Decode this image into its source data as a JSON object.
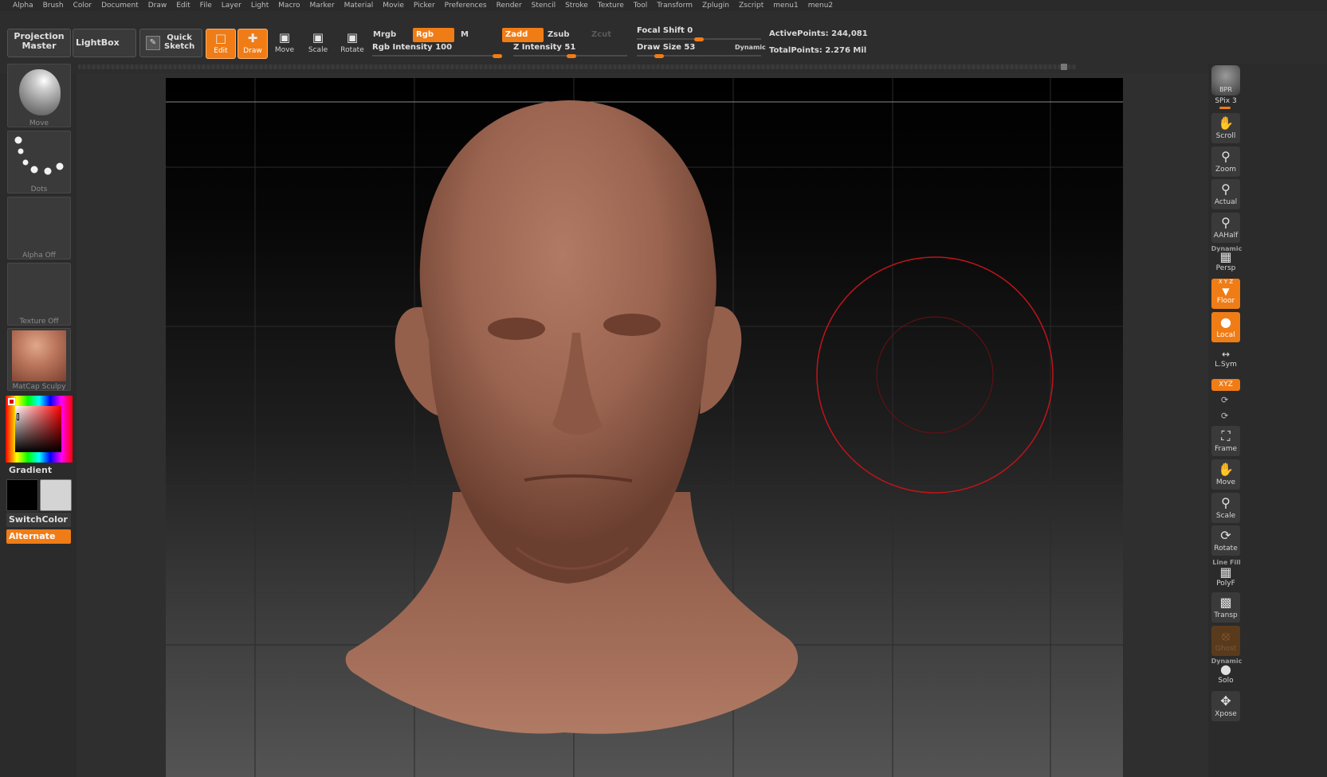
{
  "menu": [
    "Alpha",
    "Brush",
    "Color",
    "Document",
    "Draw",
    "Edit",
    "File",
    "Layer",
    "Light",
    "Macro",
    "Marker",
    "Material",
    "Movie",
    "Picker",
    "Preferences",
    "Render",
    "Stencil",
    "Stroke",
    "Texture",
    "Tool",
    "Transform",
    "Zplugin",
    "Zscript",
    "menu1",
    "menu2"
  ],
  "shelf": {
    "projection_master_line1": "Projection",
    "projection_master_line2": "Master",
    "lightbox": "LightBox",
    "quick_sketch_line1": "Quick",
    "quick_sketch_line2": "Sketch",
    "edit": "Edit",
    "draw": "Draw",
    "move": "Move",
    "scale": "Scale",
    "rotate": "Rotate",
    "mrgb": "Mrgb",
    "rgb": "Rgb",
    "m": "M",
    "zadd": "Zadd",
    "zsub": "Zsub",
    "zcut": "Zcut",
    "rgb_intensity_label": "Rgb Intensity",
    "rgb_intensity_value": "100",
    "z_intensity_label": "Z Intensity",
    "z_intensity_value": "51",
    "focal_shift_label": "Focal Shift",
    "focal_shift_value": "0",
    "draw_size_label": "Draw Size",
    "draw_size_value": "53",
    "dynamic": "Dynamic",
    "active_points_label": "ActivePoints:",
    "active_points_value": "244,081",
    "total_points_label": "TotalPoints:",
    "total_points_value": "2.276 Mil",
    "rgb_intensity_fraction": 1.0,
    "z_intensity_fraction": 0.51,
    "focal_shift_fraction": 0.5,
    "draw_size_fraction": 0.15
  },
  "left_tray": {
    "brush_label": "Move",
    "stroke_label": "Dots",
    "alpha_label": "Alpha  Off",
    "texture_label": "Texture  Off",
    "material_label": "MatCap  Sculpy",
    "gradient": "Gradient",
    "switch_color": "SwitchColor",
    "alternate": "Alternate"
  },
  "right_tray": {
    "bpr": "BPR",
    "spix": "SPix 3",
    "scroll": "Scroll",
    "zoom": "Zoom",
    "actual": "Actual",
    "aahalf": "AAHalf",
    "dynamic_tag": "Dynamic",
    "persp": "Persp",
    "floor": "Floor",
    "floor_axes": "X Y Z",
    "local": "Local",
    "lsym": "L.Sym",
    "xyz": "XYZ",
    "frame": "Frame",
    "move": "Move",
    "scale": "Scale",
    "rotate": "Rotate",
    "line_fill_tag": "Line Fill",
    "polyf": "PolyF",
    "transp": "Transp",
    "ghost": "Ghost",
    "dynamic_tag2": "Dynamic",
    "solo": "Solo",
    "xpose": "Xpose"
  },
  "colors": {
    "accent": "#f07c16",
    "skin": "#a8705a",
    "brush_ring": "#c0141a"
  }
}
